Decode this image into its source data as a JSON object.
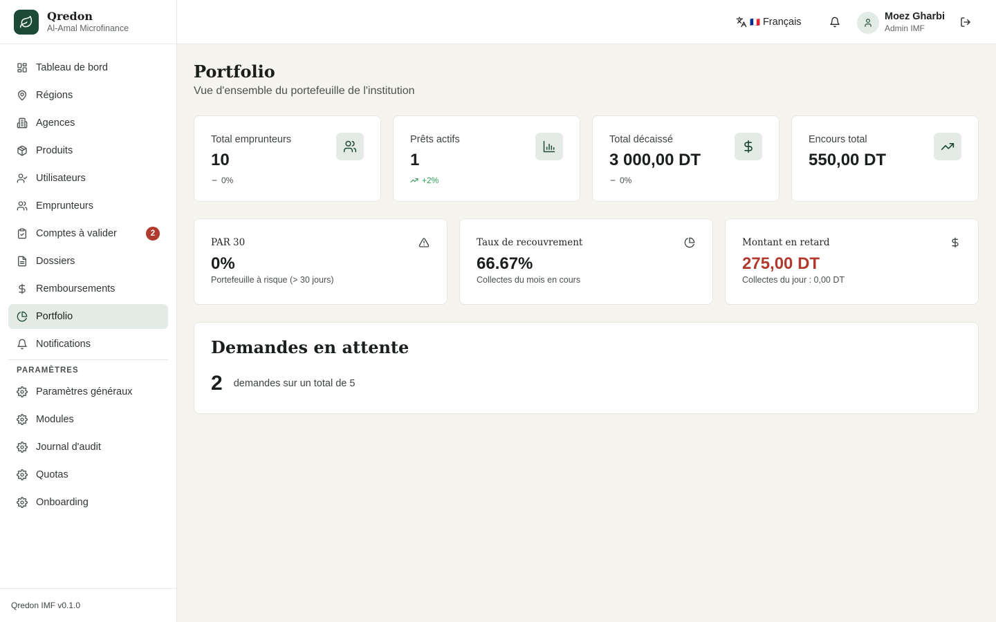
{
  "brand": {
    "name": "Qredon",
    "subtitle": "Al-Amal Microfinance",
    "logo_icon": "leaf-icon"
  },
  "sidebar": {
    "items": [
      {
        "label": "Tableau de bord",
        "icon": "layout-grid-icon"
      },
      {
        "label": "Régions",
        "icon": "map-pin-icon"
      },
      {
        "label": "Agences",
        "icon": "building-icon"
      },
      {
        "label": "Produits",
        "icon": "package-icon"
      },
      {
        "label": "Utilisateurs",
        "icon": "user-check-icon"
      },
      {
        "label": "Emprunteurs",
        "icon": "users-icon"
      },
      {
        "label": "Comptes à valider",
        "icon": "clipboard-check-icon",
        "badge": "2"
      },
      {
        "label": "Dossiers",
        "icon": "file-text-icon"
      },
      {
        "label": "Remboursements",
        "icon": "dollar-icon"
      },
      {
        "label": "Portfolio",
        "icon": "pie-chart-icon",
        "active": true
      },
      {
        "label": "Notifications",
        "icon": "bell-icon"
      }
    ],
    "section_label": "PARAMÈTRES",
    "settings_items": [
      {
        "label": "Paramètres généraux",
        "icon": "gear-icon"
      },
      {
        "label": "Modules",
        "icon": "gear-icon"
      },
      {
        "label": "Journal d'audit",
        "icon": "gear-icon"
      },
      {
        "label": "Quotas",
        "icon": "gear-icon"
      },
      {
        "label": "Onboarding",
        "icon": "gear-icon"
      }
    ],
    "footer": "Qredon IMF v0.1.0"
  },
  "header": {
    "language": {
      "flag": "🇫🇷",
      "label": "Français"
    },
    "user": {
      "name": "Moez Gharbi",
      "role": "Admin IMF"
    }
  },
  "page": {
    "title": "Portfolio",
    "subtitle": "Vue d'ensemble du portefeuille de l'institution"
  },
  "kpis": [
    {
      "label": "Total emprunteurs",
      "value": "10",
      "trend": "0%",
      "trend_dir": "flat",
      "icon": "users-icon"
    },
    {
      "label": "Prêts actifs",
      "value": "1",
      "trend": "+2%",
      "trend_dir": "up",
      "icon": "bar-chart-icon"
    },
    {
      "label": "Total décaissé",
      "value": "3 000,00 DT",
      "trend": "0%",
      "trend_dir": "flat",
      "icon": "dollar-icon"
    },
    {
      "label": "Encours total",
      "value": "550,00 DT",
      "icon": "trending-up-icon"
    }
  ],
  "metrics": [
    {
      "label": "PAR 30",
      "value": "0%",
      "sub": "Portefeuille à risque (> 30 jours)",
      "icon": "alert-triangle-icon"
    },
    {
      "label": "Taux de recouvrement",
      "value": "66.67%",
      "sub": "Collectes du mois en cours",
      "icon": "pie-chart-icon"
    },
    {
      "label": "Montant en retard",
      "value": "275,00 DT",
      "sub": "Collectes du jour : 0,00 DT",
      "icon": "dollar-icon",
      "danger": true
    }
  ],
  "pending": {
    "title": "Demandes en attente",
    "count": "2",
    "text": "demandes sur un total de 5"
  },
  "colors": {
    "primary": "#1c4a36",
    "accent_bg": "#e4ebe6",
    "danger": "#b03a2e",
    "success": "#2e9b5a",
    "background": "#f6f4ef"
  }
}
